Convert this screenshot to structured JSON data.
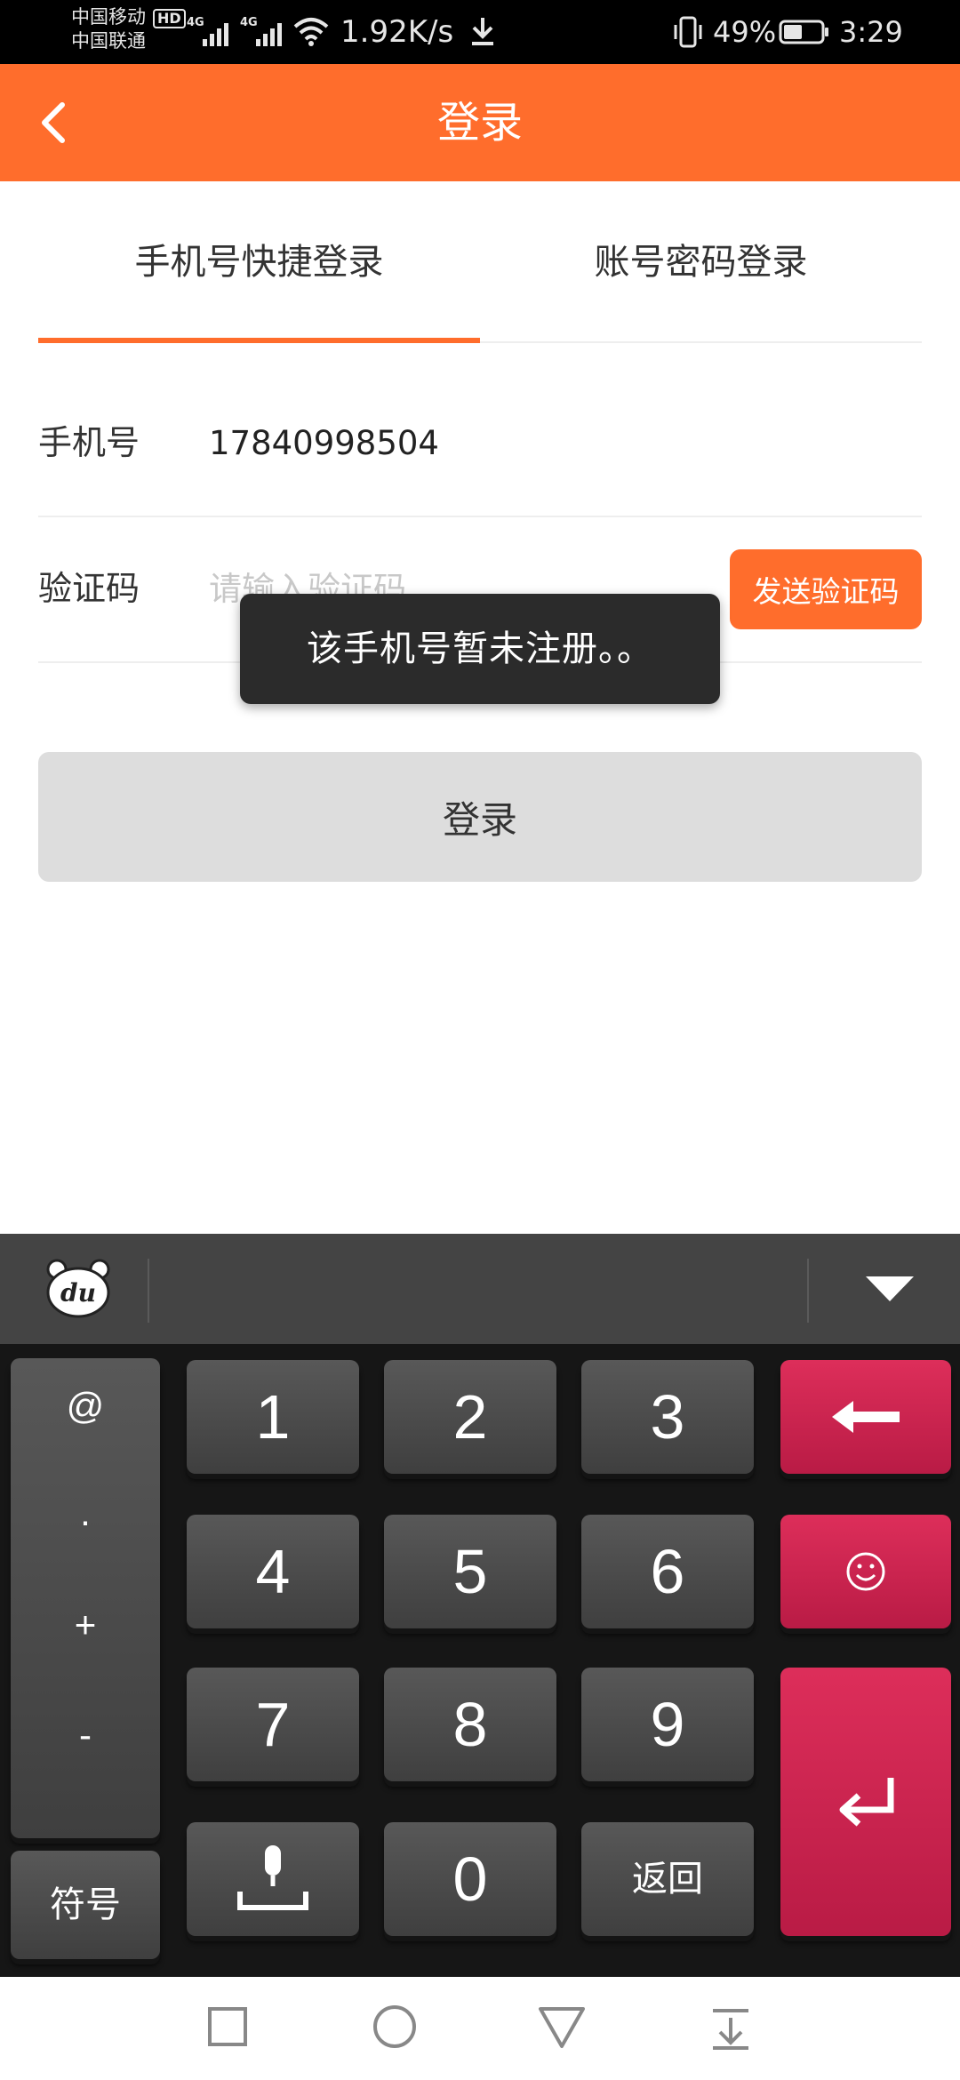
{
  "status_bar": {
    "carrier_1": "中国移动",
    "carrier_2": "中国联通",
    "hd": "HD",
    "network_1": "4G",
    "network_2": "4G",
    "net_speed": "1.92K/s",
    "battery": "49%",
    "time": "3:29"
  },
  "nav": {
    "title": "登录"
  },
  "tabs": {
    "phone_login": "手机号快捷登录",
    "account_login": "账号密码登录"
  },
  "form": {
    "phone_label": "手机号",
    "phone_value": "17840998504",
    "code_label": "验证码",
    "code_placeholder": "请输入验证码",
    "send_code": "发送验证码"
  },
  "toast": "该手机号暂未注册。。",
  "login_button": "登录",
  "keyboard": {
    "symbols": [
      "@",
      ".",
      "+",
      "-"
    ],
    "digits": [
      "1",
      "2",
      "3",
      "4",
      "5",
      "6",
      "7",
      "8",
      "9",
      "0"
    ],
    "fuhao": "符号",
    "fanhui": "返回",
    "logo_text": "du"
  },
  "colors": {
    "accent": "#ff6d2c",
    "key_red": "#c92350"
  }
}
